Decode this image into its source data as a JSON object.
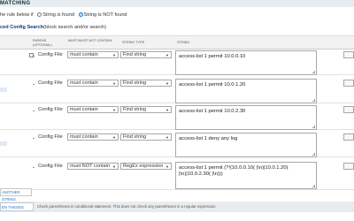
{
  "section": {
    "title": "MATCHING",
    "fail_prefix": "he rule below if",
    "options": [
      "String is found",
      "String is NOT found"
    ],
    "selected": "String is NOT found"
  },
  "advanced": {
    "title": "ced Config Search",
    "note": "(block search and/or search)"
  },
  "columns": {
    "parens": "PARENS (OPTIONAL)",
    "must": "MUST/MUST NOT CONTAIN",
    "type": "STRING TYPE",
    "string": "STRING"
  },
  "rows": [
    {
      "source": "Config File",
      "must": "must contain",
      "type": "Find string",
      "string": "access-list 1 permit 10.0.0.10",
      "blue": false,
      "check": true
    },
    {
      "source": "Config File",
      "must": "must contain",
      "type": "Find string",
      "string": "access-list 1 permit 10.0.1.20",
      "blue": true,
      "check": false
    },
    {
      "source": "Config File",
      "must": "must contain",
      "type": "Find string",
      "string": "access-list 1 permit 10.0.2.30",
      "blue": false,
      "check": false
    },
    {
      "source": "Config File",
      "must": "must contain",
      "type": "Find string",
      "string": "access-list 1 deny any log",
      "blue": true,
      "check": false
    },
    {
      "source": "Config File",
      "must": "must NOT contain",
      "type": "RegEx expression",
      "string": "access-list 1 permit (?!(10.0.0.10( |\\n)|10.0.1.20( |\\n)|10.0.2.30( |\\n)))",
      "blue": false,
      "check": false
    }
  ],
  "add_button": "ANOTHER STRING",
  "footer": {
    "button": "EN THESES",
    "note": "Check parentheses in conditional statement. This does not check any parentheses in a regular expression."
  },
  "colors": {
    "accent": "#1e74c6",
    "header_bg": "#e9edf0",
    "title": "#0a3c73"
  }
}
